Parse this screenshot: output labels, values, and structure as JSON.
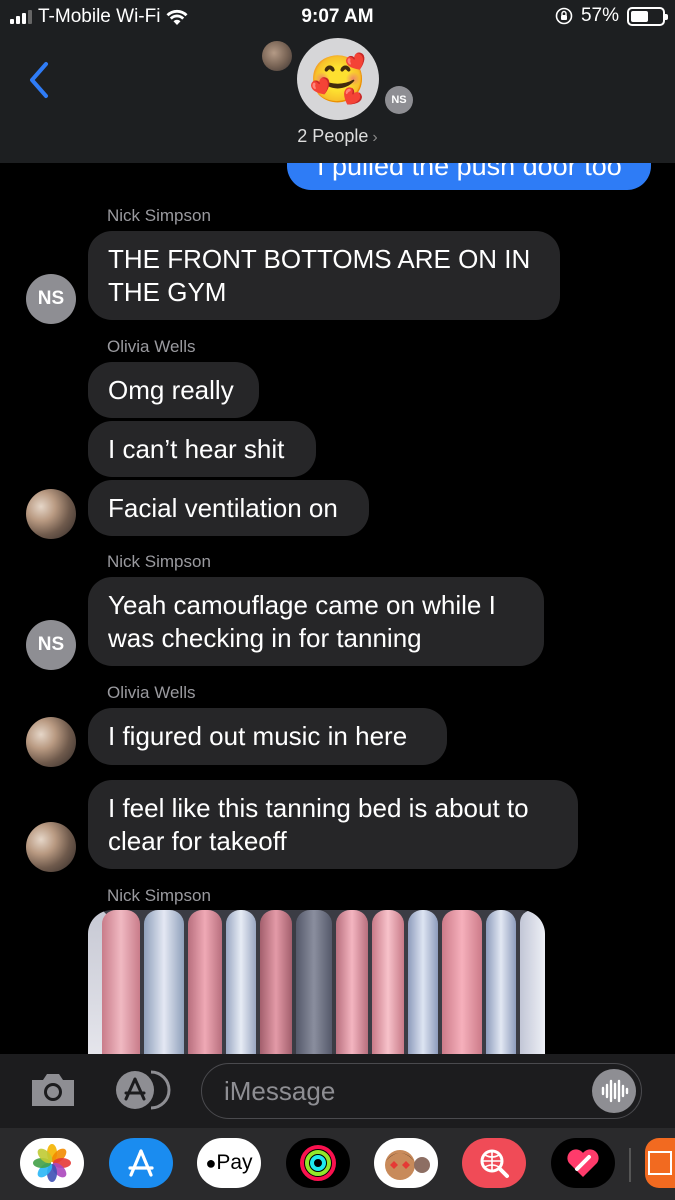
{
  "status_bar": {
    "carrier": "T-Mobile Wi-Fi",
    "time": "9:07 AM",
    "battery_percent": "57%",
    "battery_level": 0.57
  },
  "conversation": {
    "group_emoji": "🥰",
    "member_initials": "NS",
    "people_label": "2 People"
  },
  "messages": {
    "sent_partial": "I pulled the push door too",
    "groups": [
      {
        "sender": "Nick Simpson",
        "avatar_initials": "NS",
        "bubbles": [
          "THE FRONT BOTTOMS ARE ON IN\nTHE GYM"
        ]
      },
      {
        "sender": "Olivia Wells",
        "bubbles": [
          "Omg really",
          "I can’t hear shit",
          "Facial ventilation on"
        ]
      },
      {
        "sender": "Nick Simpson",
        "avatar_initials": "NS",
        "bubbles": [
          "Yeah camouflage came on while I\nwas checking in for tanning"
        ]
      },
      {
        "sender": "Olivia Wells",
        "bubbles": [
          "I figured out music in here",
          "I feel like this tanning bed is about to\nclear for takeoff"
        ]
      },
      {
        "sender": "Nick Simpson",
        "attachment": "photo"
      }
    ]
  },
  "input_bar": {
    "placeholder": "iMessage"
  },
  "drawer": {
    "applepay_label": "Pay"
  },
  "colors": {
    "sent_bubble": "#2e7cf6",
    "received_bubble": "#262628",
    "accent_blue": "#2f7cf6",
    "background": "#000000"
  }
}
